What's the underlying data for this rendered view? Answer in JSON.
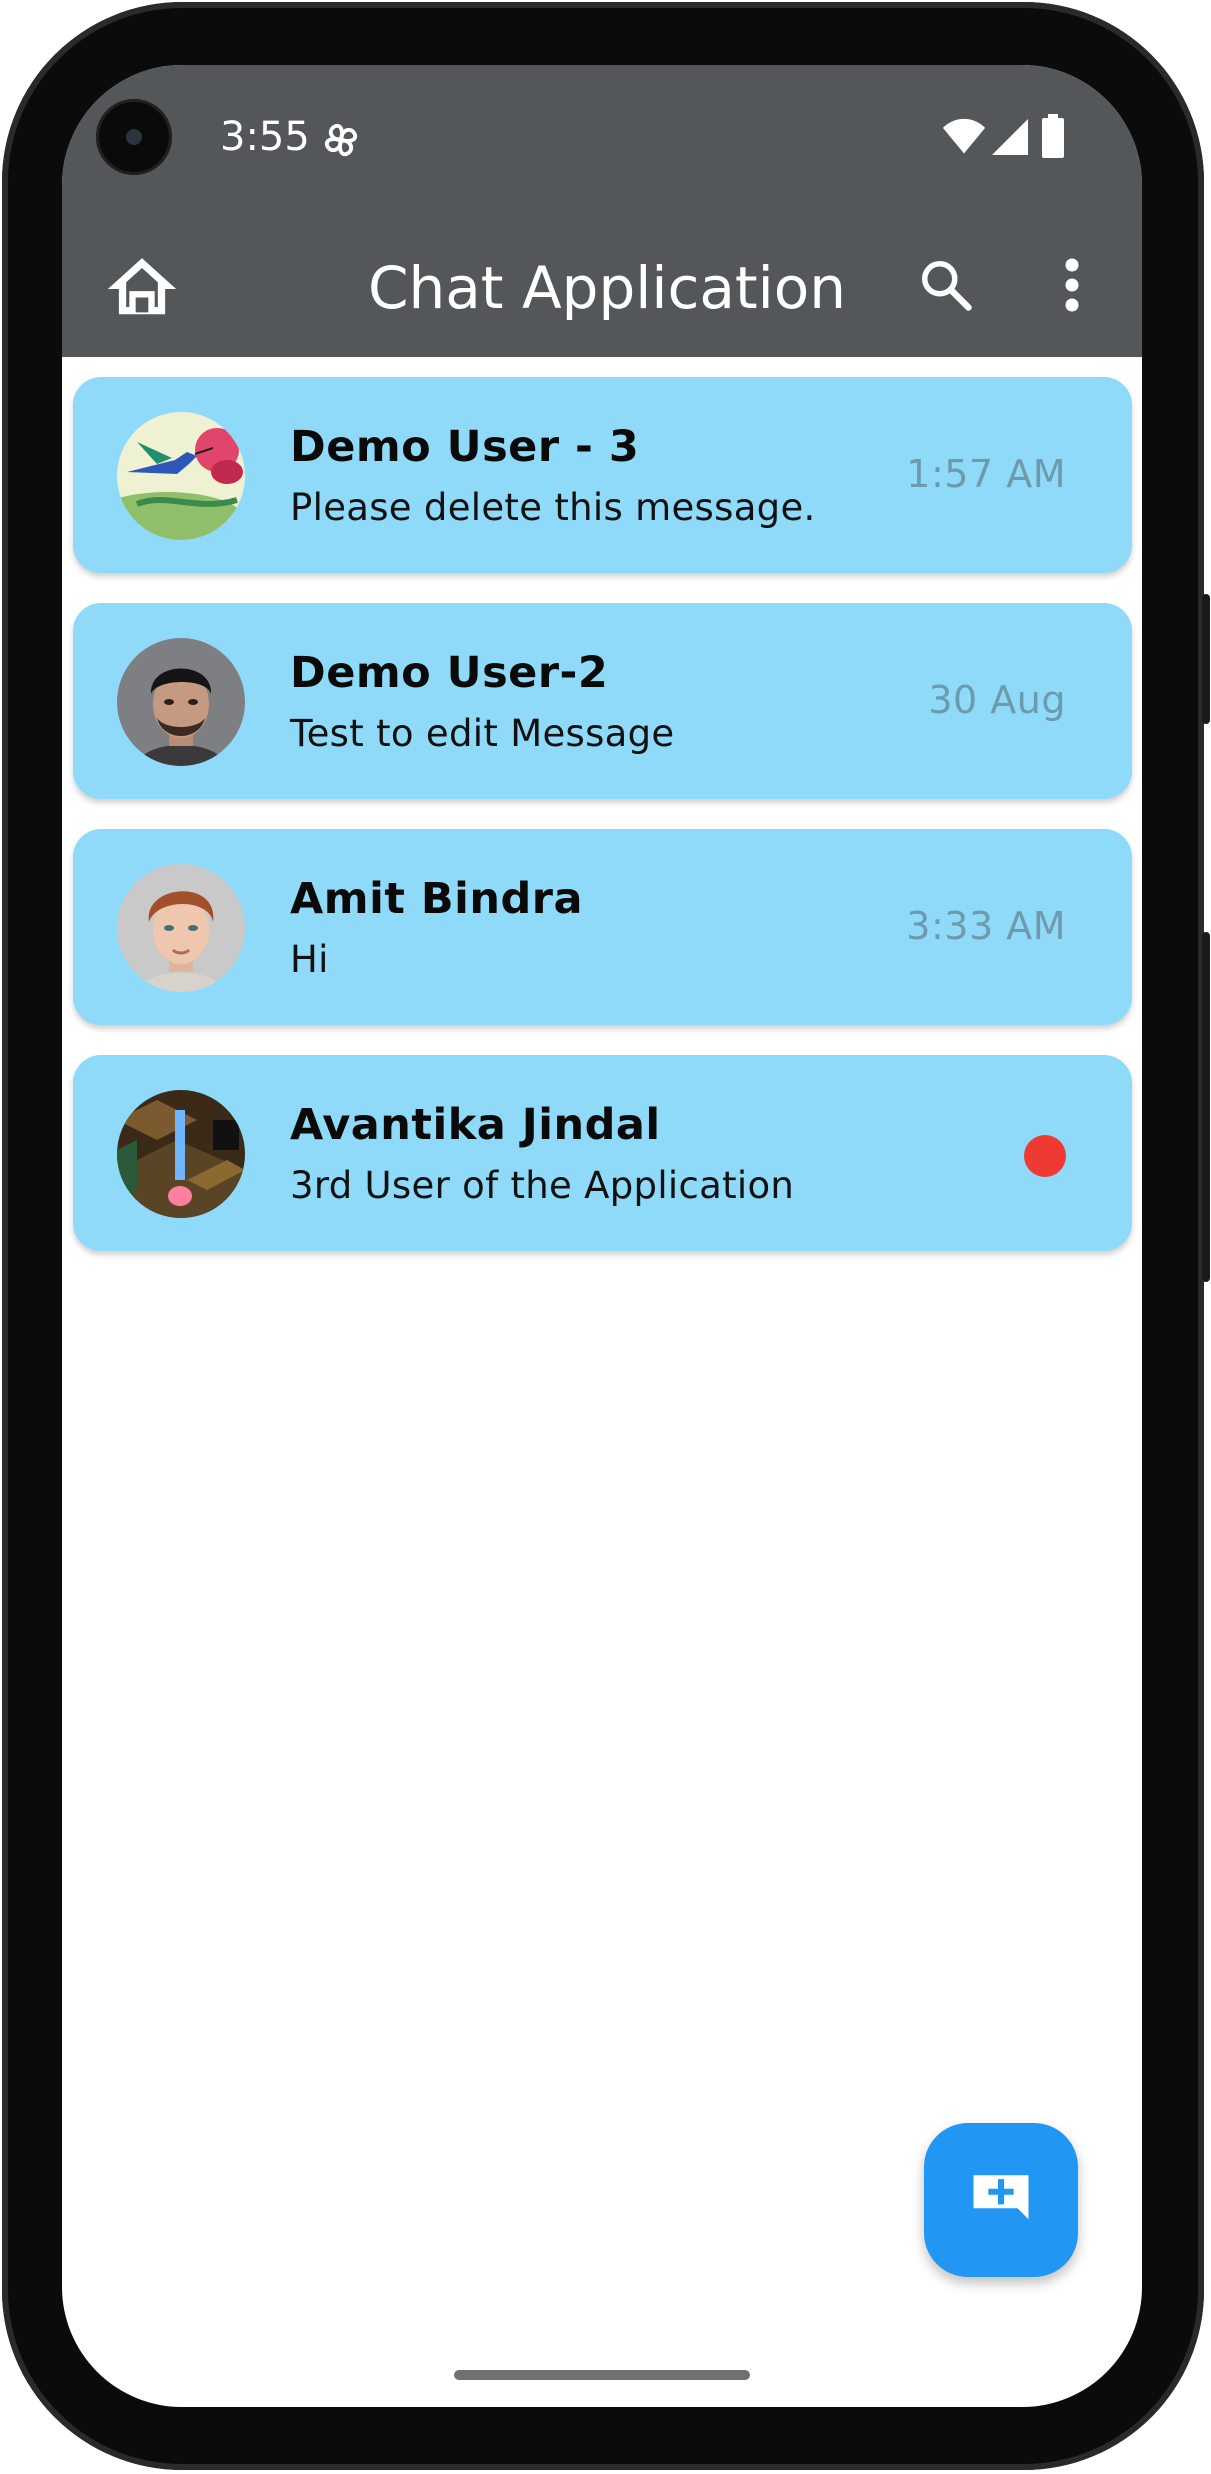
{
  "status_bar": {
    "time": "3:55"
  },
  "app_bar": {
    "title": "Chat Application"
  },
  "chats": [
    {
      "name": "Demo User - 3",
      "message": "Please delete this message.",
      "time": "1:57 AM",
      "unread": false,
      "avatar": "hummingbird-avatar"
    },
    {
      "name": "Demo User-2",
      "message": "Test to edit Message",
      "time": "30 Aug",
      "unread": false,
      "avatar": "dark-hair-man-avatar"
    },
    {
      "name": "Amit Bindra",
      "message": "Hi",
      "time": "3:33 AM",
      "unread": false,
      "avatar": "red-hair-man-avatar"
    },
    {
      "name": "Avantika Jindal",
      "message": "3rd User of the Application",
      "time": "",
      "unread": true,
      "avatar": "game-scene-avatar"
    }
  ],
  "colors": {
    "app_bar": "#53575a",
    "card": "#8fdaf9",
    "fab": "#2196f3",
    "unread_dot": "#ef3a33",
    "time_text": "#6e9aae"
  },
  "icons": {
    "home": "home-icon",
    "search": "search-icon",
    "more": "more-vert-icon",
    "fab": "add-comment-icon"
  }
}
